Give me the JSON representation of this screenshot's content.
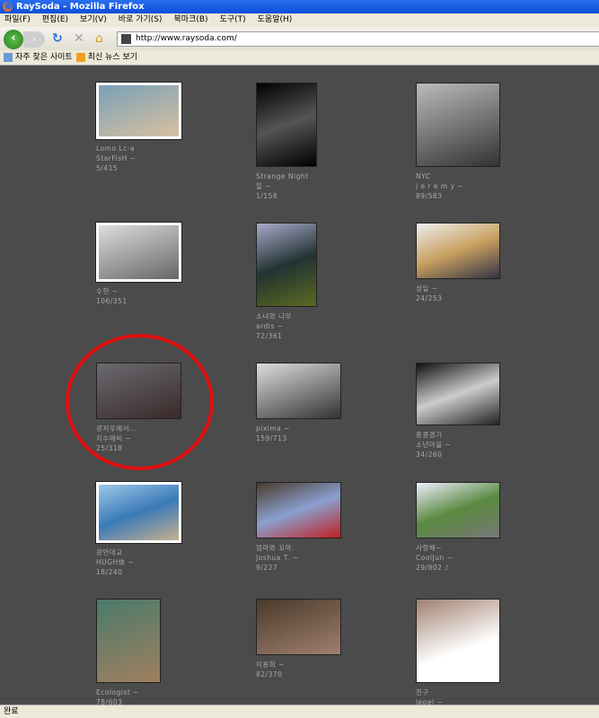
{
  "window": {
    "title": "RaySoda - Mozilla Firefox"
  },
  "menu": [
    "파일(F)",
    "편집(E)",
    "보기(V)",
    "바로 가기(S)",
    "북마크(B)",
    "도구(T)",
    "도움말(H)"
  ],
  "nav": {
    "back": "‹",
    "forward": "›",
    "reload": "↻",
    "stop": "✕",
    "home": "⌂",
    "url": "http://www.raysoda.com/"
  },
  "bookmarks": [
    "자주 찾은 사이트",
    "최신 뉴스 보기"
  ],
  "status": "완료",
  "photos": [
    {
      "title": "Lomo Lc-a",
      "author": "StarFisH ~",
      "count": "5/415"
    },
    {
      "title": "Strange Night",
      "author": "밀 ~",
      "count": "1/158"
    },
    {
      "title": "NYC",
      "author": "j e r e m y ~",
      "count": "89/583"
    },
    {
      "title": "",
      "author": "수현 ~",
      "count": "106/351"
    },
    {
      "title": "소녀와 나무",
      "author": "ardis ~",
      "count": "72/361"
    },
    {
      "title": "",
      "author": "성일 ~",
      "count": "24/253"
    },
    {
      "title": "광저우에서...",
      "author": "지수애비 ~",
      "count": "25/318"
    },
    {
      "title": "",
      "author": "pixima ~",
      "count": "159/713"
    },
    {
      "title": "홍콩경기",
      "author": "소년마을 ~",
      "count": "34/260"
    },
    {
      "title": "광안대교",
      "author": "HUGH休 ~",
      "count": "18/240"
    },
    {
      "title": "엄마와 꼬마.",
      "author": "Joshua T. ~",
      "count": "9/227"
    },
    {
      "title": "사랑해~",
      "author": "CoolJun ~",
      "count": "29/802 ♪"
    },
    {
      "title": "",
      "author": "Ecologist ~",
      "count": "78/603"
    },
    {
      "title": "",
      "author": "이용희 ~",
      "count": "82/370"
    },
    {
      "title": "친구",
      "author": "lepel ~",
      "count": ""
    }
  ]
}
